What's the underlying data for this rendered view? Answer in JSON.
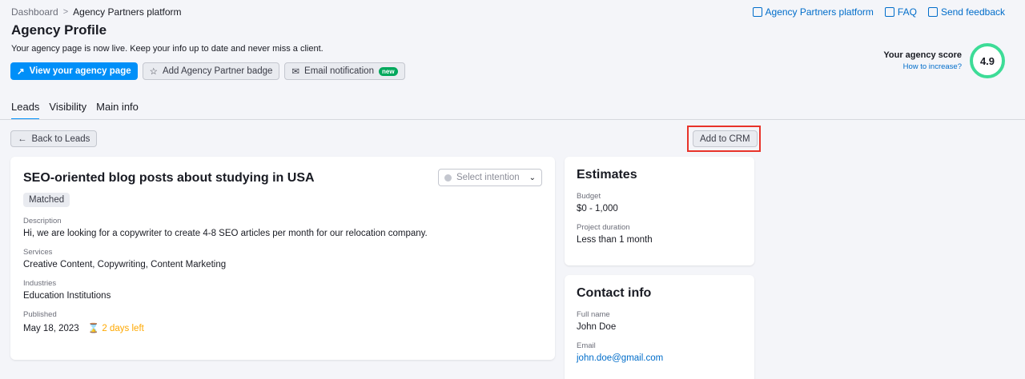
{
  "breadcrumb": {
    "root": "Dashboard",
    "separator": ">",
    "current": "Agency Partners platform"
  },
  "top_links": {
    "platform": "Agency Partners platform",
    "faq": "FAQ",
    "feedback": "Send feedback"
  },
  "header": {
    "title": "Agency Profile",
    "subtitle": "Your agency page is now live. Keep your info up to date and never miss a client.",
    "view_page_label": "View your agency page",
    "badge_label": "Add Agency Partner badge",
    "email_label": "Email notification",
    "new_badge": "new"
  },
  "score": {
    "label": "Your agency score",
    "link": "How to increase?",
    "value": "4.9"
  },
  "tabs": [
    {
      "label": "Leads"
    },
    {
      "label": "Visibility"
    },
    {
      "label": "Main info"
    }
  ],
  "actions": {
    "back": "Back to Leads",
    "add_crm": "Add to CRM"
  },
  "lead": {
    "title": "SEO-oriented blog posts about studying in USA",
    "select_placeholder": "Select intention",
    "status": "Matched",
    "description_label": "Description",
    "description": "Hi, we are looking for a copywriter to create 4-8 SEO articles per month for our relocation company.",
    "services_label": "Services",
    "services": "Creative Content, Copywriting, Content Marketing",
    "industries_label": "Industries",
    "industries": "Education Institutions",
    "published_label": "Published",
    "published": "May 18, 2023",
    "time_left": "2 days left"
  },
  "estimates": {
    "title": "Estimates",
    "budget_label": "Budget",
    "budget": "$0 - 1,000",
    "duration_label": "Project duration",
    "duration": "Less than 1 month"
  },
  "contact": {
    "title": "Contact info",
    "name_label": "Full name",
    "name": "John Doe",
    "email_label": "Email",
    "email": "john.doe@gmail.com"
  },
  "colors": {
    "primary": "#008ff8",
    "score_ring": "#3ddc97",
    "highlight": "#e8332a",
    "timer": "#ffa800"
  }
}
